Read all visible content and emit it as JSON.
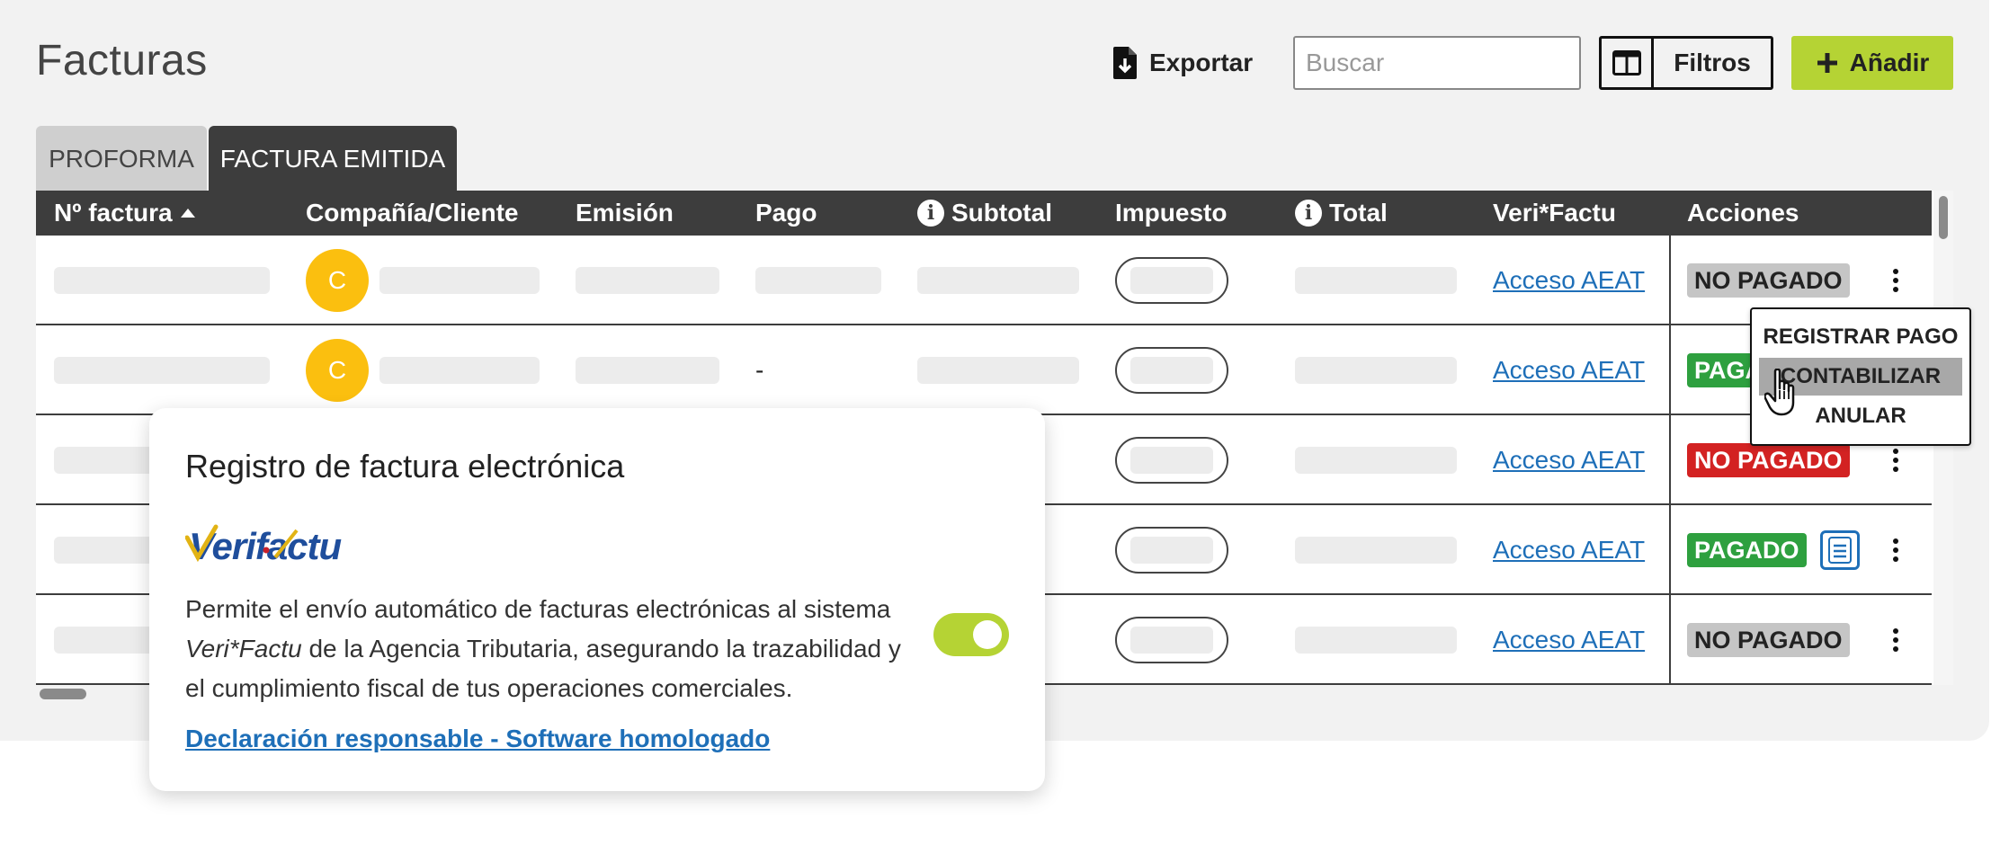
{
  "header": {
    "title": "Facturas",
    "export_label": "Exportar",
    "search_placeholder": "Buscar",
    "filters_label": "Filtros",
    "add_label": "Añadir"
  },
  "tabs": [
    {
      "label": "PROFORMA",
      "active": false
    },
    {
      "label": "FACTURA EMITIDA",
      "active": true
    }
  ],
  "table": {
    "columns": [
      "Nº factura",
      "Compañía/Cliente",
      "Emisión",
      "Pago",
      "Subtotal",
      "Impuesto",
      "Total",
      "Veri*Factu",
      "Acciones"
    ],
    "rows": [
      {
        "avatar": "C",
        "pago": "",
        "link": "Acceso AEAT",
        "status": "NO PAGADO",
        "status_color": "grey"
      },
      {
        "avatar": "C",
        "pago": "-",
        "link": "Acceso AEAT",
        "status": "PAGADO",
        "status_color": "green"
      },
      {
        "avatar": "",
        "pago": "",
        "link": "Acceso AEAT",
        "status": "NO PAGADO",
        "status_color": "red"
      },
      {
        "avatar": "",
        "pago": "",
        "link": "Acceso AEAT",
        "status": "PAGADO",
        "status_color": "green"
      },
      {
        "avatar": "",
        "pago": "",
        "link": "Acceso AEAT",
        "status": "NO PAGADO",
        "status_color": "grey"
      }
    ]
  },
  "context_menu": {
    "items": [
      "REGISTRAR PAGO",
      "CONTABILIZAR",
      "ANULAR"
    ],
    "highlighted": "CONTABILIZAR"
  },
  "popup": {
    "title": "Registro de factura electrónica",
    "logo_text": "Verifactu",
    "desc_1": "Permite el envío automático de facturas electrónicas al sistema",
    "desc_em": "Veri*Factu",
    "desc_2": " de la Agencia Tributaria, asegurando la trazabilidad y el cumplimiento fiscal de tus operaciones comerciales.",
    "toggle_on": true,
    "link": "Declaración responsable - Software homologado"
  },
  "colors": {
    "accent": "#b5d334",
    "header_bg": "#3d3d3d",
    "link": "#1e6fb8",
    "status_red": "#d32222",
    "status_green": "#2ea03f",
    "status_grey": "#c5c5c5",
    "avatar": "#fbbf0f"
  }
}
